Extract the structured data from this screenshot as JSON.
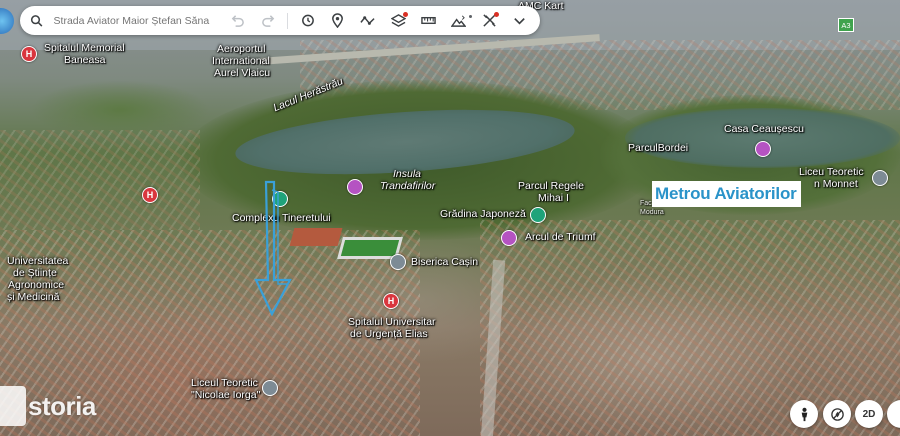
{
  "search": {
    "placeholder": "Strada Aviator Maior Ștefan Săna"
  },
  "toolbar": {
    "icons": [
      "search-icon",
      "undo-icon",
      "redo-icon",
      "history-icon",
      "place-icon",
      "path-icon",
      "layers-icon",
      "measure-icon",
      "photo-icon",
      "settings-icon",
      "chevron-down-icon"
    ]
  },
  "badge": {
    "road_marker": "A3"
  },
  "overlay": {
    "metro_label": "Metrou Aviatorilor"
  },
  "map_labels": {
    "amc_kart": "AMC Kart",
    "spital_baneasa_1": "Spitalul Memorial",
    "spital_baneasa_2": "Baneasa",
    "aeroport_1": "Aeroportul",
    "aeroport_2": "International",
    "aeroport_3": "Aurel Vlaicu",
    "lacul": "Lacul Herăstrău",
    "casa": "Casa Ceaușescu",
    "parcul_bordei": "ParculBordei",
    "liceu_monnet_1": "Liceu Teoretic",
    "liceu_monnet_2": "n Monnet",
    "insula_1": "Insula",
    "insula_2": "Trandafirilor",
    "parcul_regele_1": "Parcul Regele",
    "parcul_regele_2": "Mihai I",
    "complexul": "Complexu Tineretului",
    "gradina": "Grădina Japoneză",
    "arcul": "Arcul de Triumf",
    "biserica": "Biserica Cașin",
    "univ_1": "Universitatea",
    "univ_2": "de Științe",
    "univ_3": "Agronomice",
    "univ_4": "și Medicină",
    "spital_elias_1": "Spitalul Universitar",
    "spital_elias_2": "de Urgență Elias",
    "liceu_iorga_1": "Liceul Teoretic",
    "liceu_iorga_2": "\"Nicolae Iorga\"",
    "faculty_small_1": "Fac",
    "faculty_small_2": "Modura",
    "hosp_glyph": "H"
  },
  "watermark": {
    "brand": "storia"
  },
  "controls": {
    "view_2d": "2D"
  },
  "colors": {
    "metro_text": "#2a93c9",
    "hospital_pin": "#d9363e",
    "landmark_pin": "#b553c2",
    "park_pin": "#1fa37a",
    "school_pin": "#7d8b95",
    "annotation_arrow": "#3aa0d8",
    "road_badge": "#3fa34d"
  }
}
